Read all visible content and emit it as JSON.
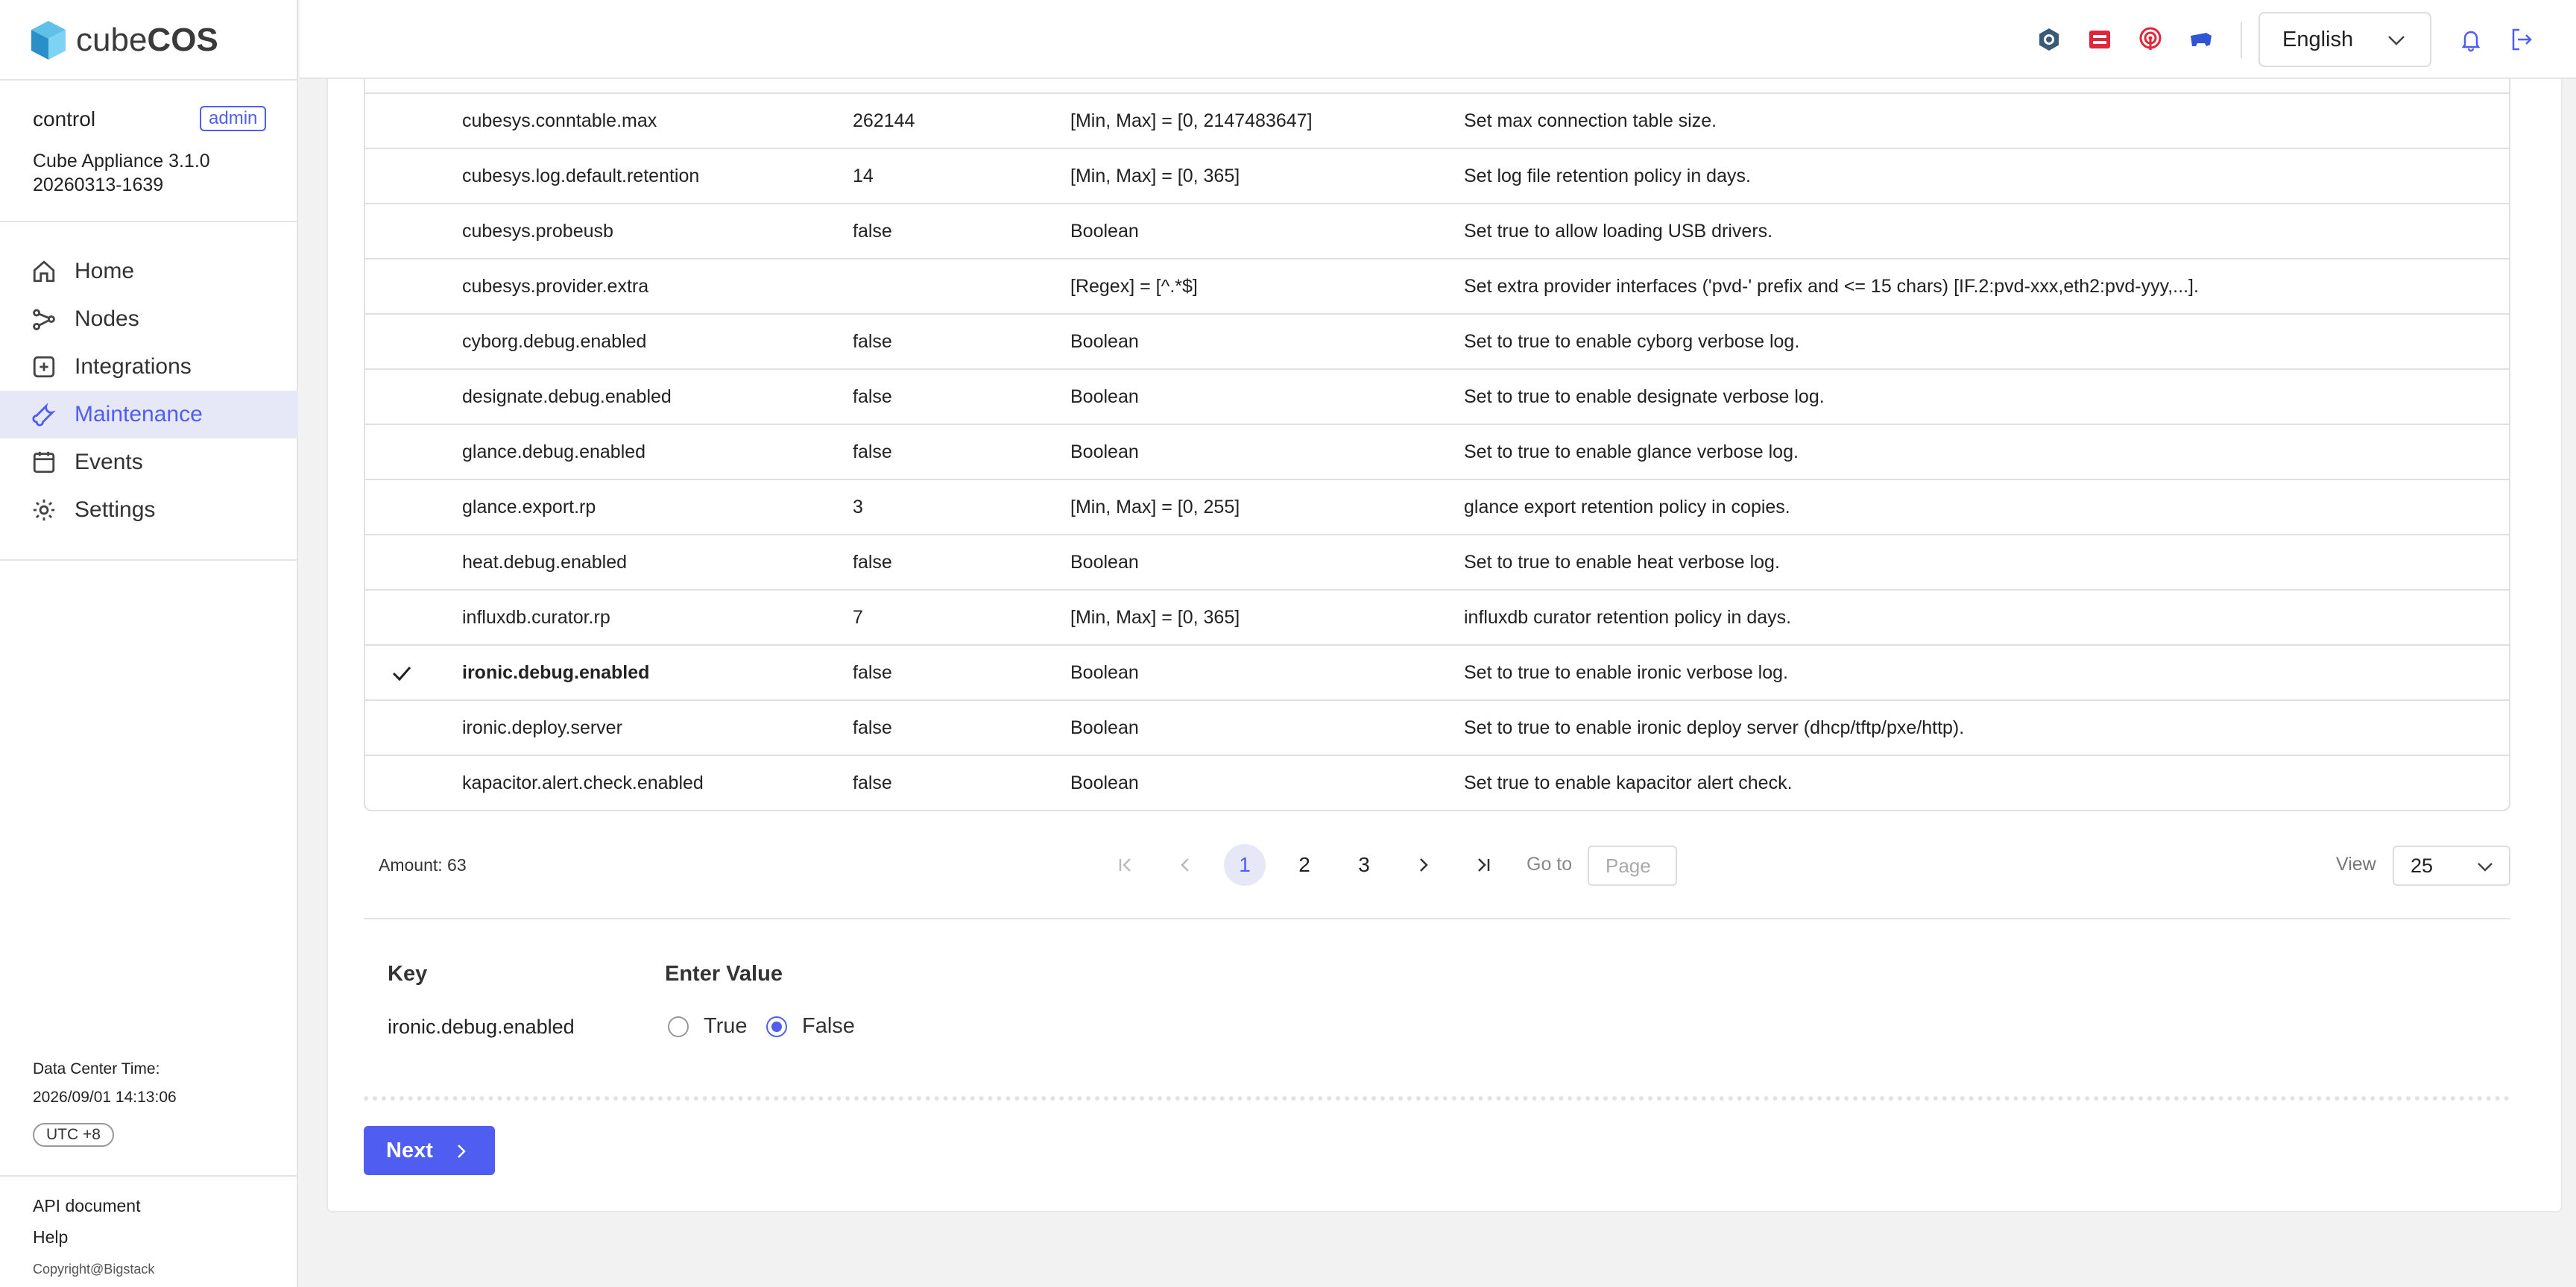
{
  "brand": {
    "logo_prefix": "cube",
    "logo_suffix": "COS"
  },
  "sidebar": {
    "host": "control",
    "role_badge": "admin",
    "appliance_line1": "Cube Appliance 3.1.0",
    "appliance_line2": "20260313-1639",
    "nav": [
      {
        "label": "Home",
        "icon": "home-icon"
      },
      {
        "label": "Nodes",
        "icon": "nodes-icon"
      },
      {
        "label": "Integrations",
        "icon": "integrations-icon"
      },
      {
        "label": "Maintenance",
        "icon": "wrench-icon",
        "active": true
      },
      {
        "label": "Events",
        "icon": "events-icon"
      },
      {
        "label": "Settings",
        "icon": "gear-icon"
      }
    ],
    "dc_time_label": "Data Center Time:",
    "dc_time_value": "2026/09/01 14:13:06",
    "timezone": "UTC +8",
    "api_doc": "API document",
    "help": "Help",
    "copyright": "Copyright@Bigstack"
  },
  "header": {
    "language": "English",
    "icons": [
      "openstack-icon",
      "redhat-icon",
      "podcast-icon",
      "kubernetes-icon",
      "notification-icon",
      "logout-icon"
    ],
    "accent": "#4f5ef0"
  },
  "table": {
    "rows": [
      {
        "key": "cubesys.conntable.max",
        "value": "262144",
        "rule": "[Min, Max] = [0, 2147483647]",
        "desc": "Set max connection table size."
      },
      {
        "key": "cubesys.log.default.retention",
        "value": "14",
        "rule": "[Min, Max] = [0, 365]",
        "desc": "Set log file retention policy in days."
      },
      {
        "key": "cubesys.probeusb",
        "value": "false",
        "rule": "Boolean",
        "desc": "Set true to allow loading USB drivers."
      },
      {
        "key": "cubesys.provider.extra",
        "value": "",
        "rule": "[Regex] = [^.*$]",
        "desc": "Set extra provider interfaces ('pvd-' prefix and <= 15 chars) [IF.2:pvd-xxx,eth2:pvd-yyy,...]."
      },
      {
        "key": "cyborg.debug.enabled",
        "value": "false",
        "rule": "Boolean",
        "desc": "Set to true to enable cyborg verbose log."
      },
      {
        "key": "designate.debug.enabled",
        "value": "false",
        "rule": "Boolean",
        "desc": "Set to true to enable designate verbose log."
      },
      {
        "key": "glance.debug.enabled",
        "value": "false",
        "rule": "Boolean",
        "desc": "Set to true to enable glance verbose log."
      },
      {
        "key": "glance.export.rp",
        "value": "3",
        "rule": "[Min, Max] = [0, 255]",
        "desc": "glance export retention policy in copies."
      },
      {
        "key": "heat.debug.enabled",
        "value": "false",
        "rule": "Boolean",
        "desc": "Set to true to enable heat verbose log."
      },
      {
        "key": "influxdb.curator.rp",
        "value": "7",
        "rule": "[Min, Max] = [0, 365]",
        "desc": "influxdb curator retention policy in days."
      },
      {
        "key": "ironic.debug.enabled",
        "value": "false",
        "rule": "Boolean",
        "desc": "Set to true to enable ironic verbose log.",
        "selected": true
      },
      {
        "key": "ironic.deploy.server",
        "value": "false",
        "rule": "Boolean",
        "desc": "Set to true to enable ironic deploy server (dhcp/tftp/pxe/http)."
      },
      {
        "key": "kapacitor.alert.check.enabled",
        "value": "false",
        "rule": "Boolean",
        "desc": "Set true to enable kapacitor alert check."
      }
    ]
  },
  "pagination": {
    "amount": "Amount: 63",
    "pages": [
      "1",
      "2",
      "3"
    ],
    "current_page": "1",
    "goto_label": "Go to",
    "page_placeholder": "Page",
    "view_label": "View",
    "view_value": "25"
  },
  "form": {
    "key_title": "Key",
    "key_value": "ironic.debug.enabled",
    "value_title": "Enter Value",
    "option_true": "True",
    "option_false": "False",
    "selected": "False",
    "next_label": "Next"
  }
}
